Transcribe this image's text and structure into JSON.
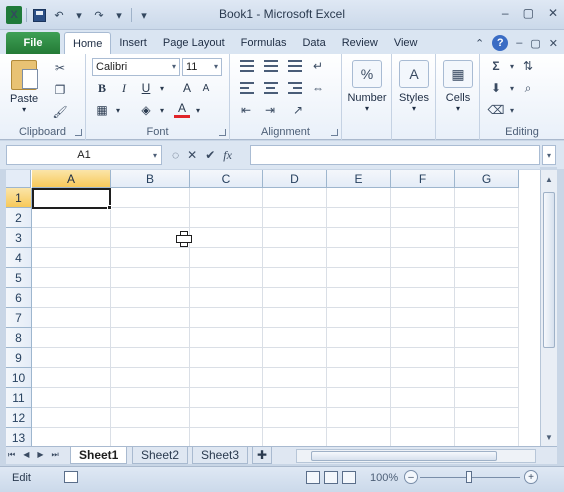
{
  "window": {
    "title": "Book1 - Microsoft Excel",
    "logo_letter": "X"
  },
  "qat": {
    "undo_icon": "undo-icon",
    "redo_icon": "redo-icon"
  },
  "tabs": {
    "file": "File",
    "items": [
      "Home",
      "Insert",
      "Page Layout",
      "Formulas",
      "Data",
      "Review",
      "View"
    ],
    "active": "Home"
  },
  "ribbon": {
    "clipboard": {
      "label": "Clipboard",
      "paste": "Paste"
    },
    "font": {
      "label": "Font",
      "name": "Calibri",
      "size": "11",
      "bold": "B",
      "italic": "I",
      "underline": "U"
    },
    "alignment": {
      "label": "Alignment"
    },
    "number": {
      "label": "Number",
      "icon_text": "%"
    },
    "styles": {
      "label": "Styles",
      "icon_text": "A"
    },
    "cells": {
      "label": "Cells"
    },
    "editing": {
      "label": "Editing",
      "sum_icon_text": "Σ"
    }
  },
  "formula_bar": {
    "name_box": "A1",
    "fx": "fx",
    "value": ""
  },
  "grid": {
    "columns": [
      "A",
      "B",
      "C",
      "D",
      "E",
      "F",
      "G"
    ],
    "rows": [
      "1",
      "2",
      "3",
      "4",
      "5",
      "6",
      "7",
      "8",
      "9",
      "10",
      "11",
      "12",
      "13"
    ],
    "selected_cell": "A1"
  },
  "sheets": {
    "tabs": [
      "Sheet1",
      "Sheet2",
      "Sheet3"
    ],
    "active": "Sheet1"
  },
  "status": {
    "mode": "Edit",
    "zoom": "100%"
  },
  "colors": {
    "file_tab": "#247a36",
    "header_selected": "#f7c95a"
  }
}
